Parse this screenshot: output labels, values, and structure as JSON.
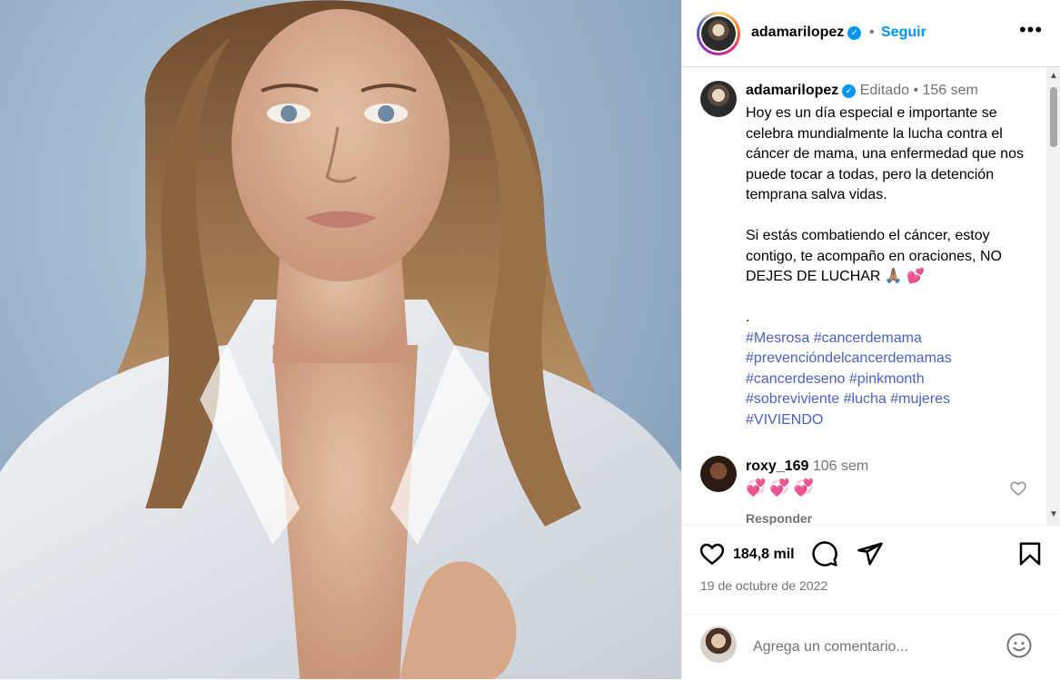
{
  "header": {
    "username": "adamarilopez",
    "verified_icon": "verified-badge-icon",
    "separator": "•",
    "follow_label": "Seguir",
    "more_label": "•••"
  },
  "caption": {
    "username": "adamarilopez",
    "edited_label": "Editado",
    "separator": "•",
    "age": "156 sem",
    "paragraph1": "Hoy es un día especial e importante se celebra mundialmente la lucha contra el cáncer de mama, una enfermedad que nos puede tocar a todas, pero la detención temprana salva vidas.",
    "paragraph2": "Si estás combatiendo el cáncer, estoy contigo, te acompaño en oraciones, NO DEJES DE LUCHAR 🙏🏽 💕",
    "dot": ".",
    "hashtags": [
      "#Mesrosa",
      "#cancerdemama",
      "#prevencióndelcancerdemamas",
      "#cancerdeseno",
      "#pinkmonth",
      "#sobreviviente",
      "#lucha",
      "#mujeres",
      "#VIVIENDO"
    ]
  },
  "comment": {
    "username": "roxy_169",
    "age": "106 sem",
    "text": "💞💞💞",
    "reply_label": "Responder"
  },
  "actions": {
    "likes": "184,8 mil",
    "date": "19 de octubre de 2022"
  },
  "add_comment": {
    "placeholder": "Agrega un comentario..."
  },
  "colors": {
    "link_blue": "#0095f6",
    "hashtag": "#4a61c9",
    "muted": "#737373"
  }
}
